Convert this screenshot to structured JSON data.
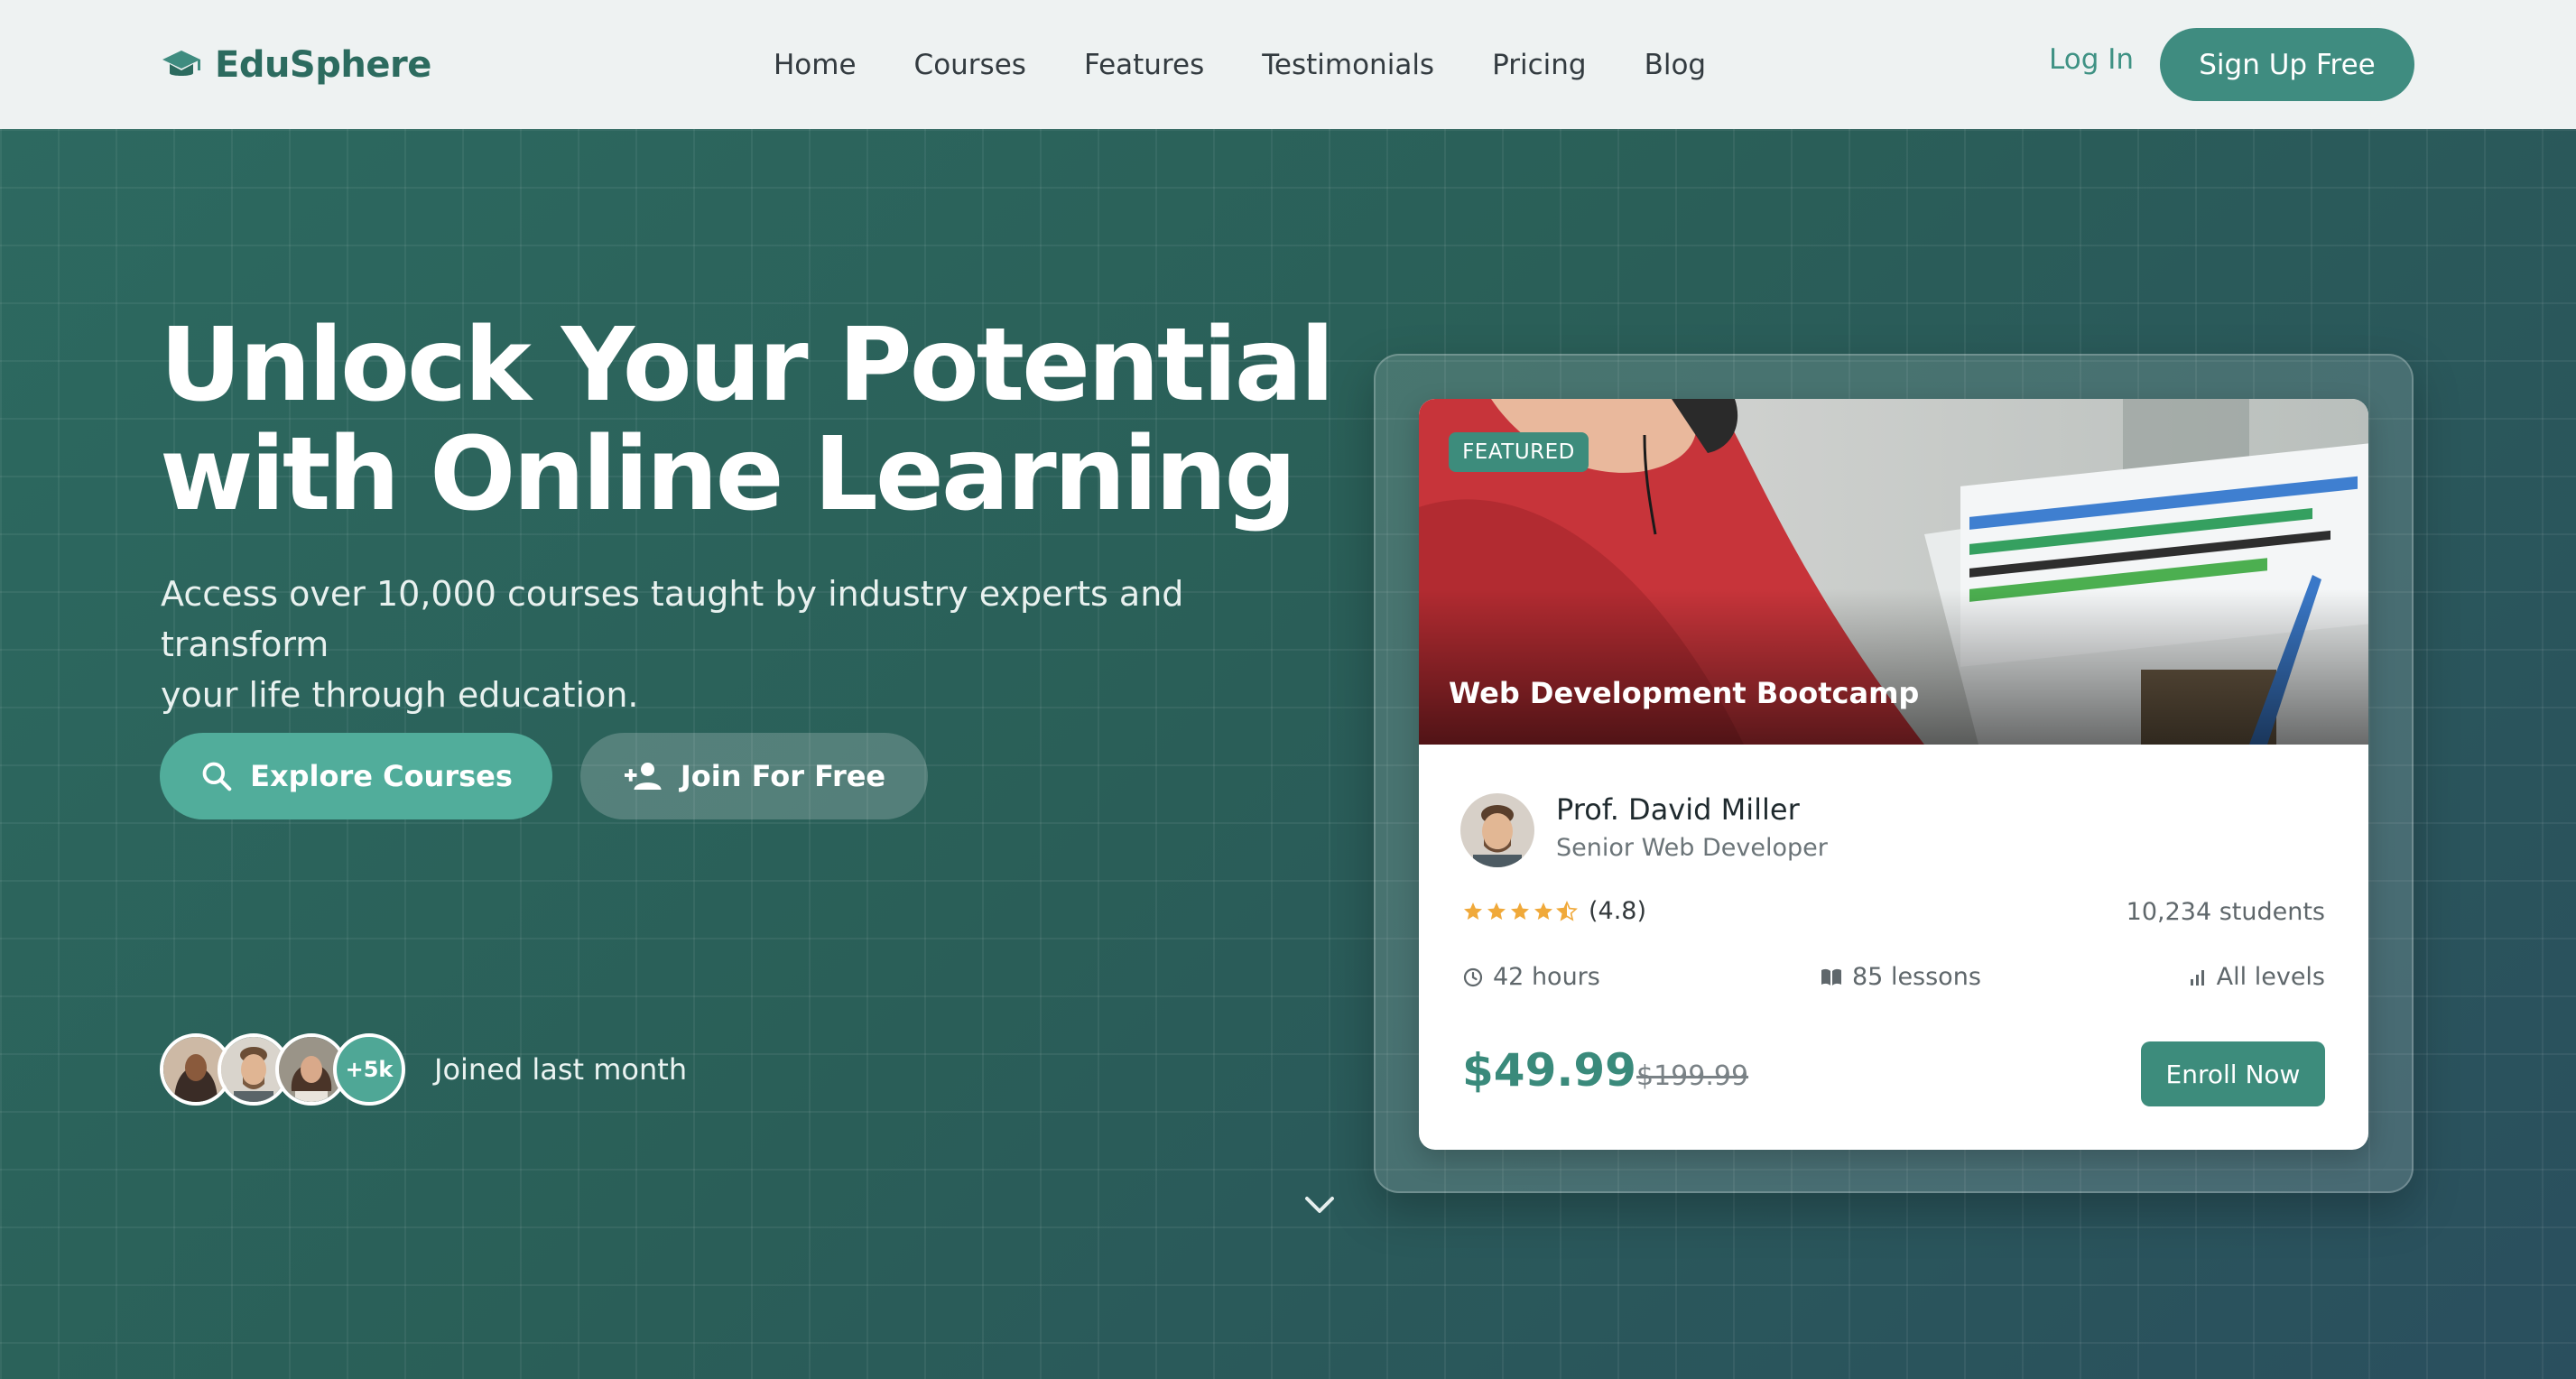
{
  "brand": {
    "name": "EduSphere",
    "icon": "graduation-cap-icon",
    "color": "#2c6b5f"
  },
  "nav": {
    "items": [
      {
        "label": "Home"
      },
      {
        "label": "Courses"
      },
      {
        "label": "Features"
      },
      {
        "label": "Testimonials"
      },
      {
        "label": "Pricing"
      },
      {
        "label": "Blog"
      }
    ],
    "login_label": "Log In",
    "signup_label": "Sign Up Free"
  },
  "hero": {
    "headline_line1": "Unlock Your Potential",
    "headline_line2": "with Online Learning",
    "subtitle_line1": "Access over 10,000 courses taught by industry experts and transform",
    "subtitle_line2": "your life through education.",
    "explore_label": "Explore Courses",
    "explore_icon": "search-icon",
    "join_label": "Join For Free",
    "join_icon": "add-user-icon",
    "avatars_more": "+5k",
    "joined_text": "Joined last month",
    "scroll_icon": "chevron-down-icon"
  },
  "course": {
    "badge": "FEATURED",
    "title": "Web Development Bootcamp",
    "instructor_name": "Prof. David Miller",
    "instructor_role": "Senior Web Developer",
    "rating_stars": 4.5,
    "rating_text": "(4.8)",
    "students": "10,234 students",
    "duration": "42 hours",
    "lessons": "85 lessons",
    "level": "All levels",
    "price": "$49.99",
    "old_price": "$199.99",
    "enroll_label": "Enroll Now"
  },
  "colors": {
    "accent": "#3d8c7c",
    "accent_light": "#51ad9b",
    "star": "#f0a93a",
    "hero_bg": "#2d6960"
  }
}
